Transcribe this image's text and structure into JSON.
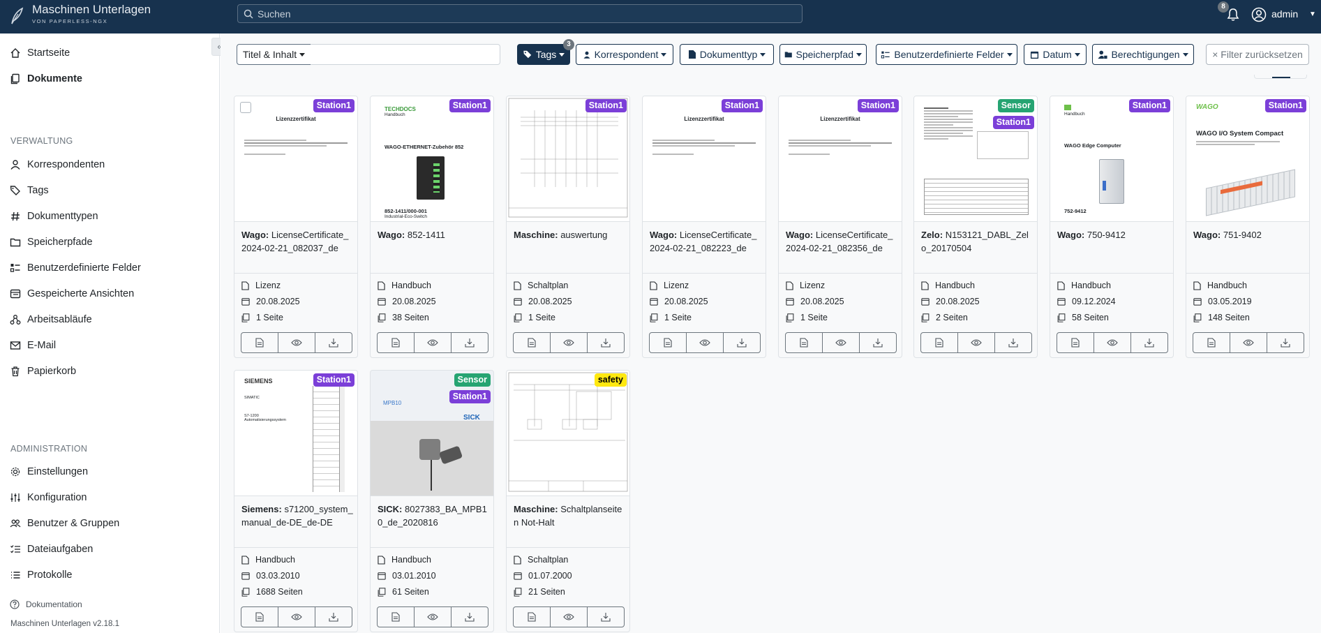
{
  "app": {
    "title": "Maschinen Unterlagen",
    "subtitle": "VON PAPERLESS-NGX",
    "version": "Maschinen Unterlagen v2.18.1"
  },
  "header": {
    "search_placeholder": "Suchen",
    "notification_count": "8",
    "user": "admin"
  },
  "sidebar": {
    "items": [
      {
        "label": "Startseite",
        "icon": "home-icon"
      },
      {
        "label": "Dokumente",
        "icon": "documents-icon"
      }
    ],
    "verwaltung_heading": "VERWALTUNG",
    "verwaltung": [
      {
        "label": "Korrespondenten",
        "icon": "person-icon"
      },
      {
        "label": "Tags",
        "icon": "tags-icon"
      },
      {
        "label": "Dokumenttypen",
        "icon": "hash-icon"
      },
      {
        "label": "Speicherpfade",
        "icon": "folder-icon"
      },
      {
        "label": "Benutzerdefinierte Felder",
        "icon": "ui-checks-icon"
      },
      {
        "label": "Gespeicherte Ansichten",
        "icon": "saved-views-icon"
      },
      {
        "label": "Arbeitsabläufe",
        "icon": "workflow-icon"
      },
      {
        "label": "E-Mail",
        "icon": "envelope-icon"
      },
      {
        "label": "Papierkorb",
        "icon": "trash-icon"
      }
    ],
    "administration_heading": "ADMINISTRATION",
    "administration": [
      {
        "label": "Einstellungen",
        "icon": "gear-icon"
      },
      {
        "label": "Konfiguration",
        "icon": "sliders-icon"
      },
      {
        "label": "Benutzer & Gruppen",
        "icon": "people-icon"
      },
      {
        "label": "Dateiaufgaben",
        "icon": "list-task-icon"
      },
      {
        "label": "Protokolle",
        "icon": "list-icon"
      }
    ],
    "documentation": "Dokumentation"
  },
  "filters": {
    "titel": "Titel & Inhalt",
    "tags": "Tags",
    "tags_count": "3",
    "korrespondent": "Korrespondent",
    "dokumenttyp": "Dokumenttyp",
    "speicherpfad": "Speicherpfad",
    "felder": "Benutzerdefinierte Felder",
    "datum": "Datum",
    "berechtigungen": "Berechtigungen",
    "reset": "× Filter zurücksetzen"
  },
  "cards": [
    {
      "correspondent": "Wago:",
      "title": "LicenseCertificate_2024-02-21_082037_de",
      "tags": [
        "Station1"
      ],
      "type": "Lizenz",
      "date": "20.08.2025",
      "pages": "1 Seite",
      "thumb": "cert",
      "thumb_title": "Lizenzzertifikat"
    },
    {
      "correspondent": "Wago:",
      "title": "852-1411",
      "tags": [
        "Station1"
      ],
      "type": "Handbuch",
      "date": "20.08.2025",
      "pages": "38 Seiten",
      "thumb": "switch",
      "thumb_logo": "TECHDOCS",
      "thumb_sub": "Handbuch",
      "thumb_title": "WAGO-ETHERNET-Zubehör 852",
      "thumb_foot": "852-1411/000-001",
      "thumb_foot2": "Industrial-Eco-Switch"
    },
    {
      "correspondent": "Maschine:",
      "title": "auswertung",
      "tags": [
        "Station1"
      ],
      "type": "Schaltplan",
      "date": "20.08.2025",
      "pages": "1 Seite",
      "thumb": "schematic"
    },
    {
      "correspondent": "Wago:",
      "title": "LicenseCertificate_2024-02-21_082223_de",
      "tags": [
        "Station1"
      ],
      "type": "Lizenz",
      "date": "20.08.2025",
      "pages": "1 Seite",
      "thumb": "cert",
      "thumb_title": "Lizenzzertifikat"
    },
    {
      "correspondent": "Wago:",
      "title": "LicenseCertificate_2024-02-21_082356_de",
      "tags": [
        "Station1"
      ],
      "type": "Lizenz",
      "date": "20.08.2025",
      "pages": "1 Seite",
      "thumb": "cert",
      "thumb_title": "Lizenzzertifikat"
    },
    {
      "correspondent": "Zelo:",
      "title": "N153121_DABL_Zelo_20170504",
      "tags": [
        "Sensor",
        "Station1"
      ],
      "type": "Handbuch",
      "date": "20.08.2025",
      "pages": "2 Seiten",
      "thumb": "datasheet"
    },
    {
      "correspondent": "Wago:",
      "title": "750-9412",
      "tags": [
        "Station1"
      ],
      "type": "Handbuch",
      "date": "09.12.2024",
      "pages": "58 Seiten",
      "thumb": "edge",
      "thumb_sub": "Handbuch",
      "thumb_title": "WAGO Edge Computer",
      "thumb_foot": "752-9412"
    },
    {
      "correspondent": "Wago:",
      "title": "751-9402",
      "tags": [
        "Station1"
      ],
      "type": "Handbuch",
      "date": "03.05.2019",
      "pages": "148 Seiten",
      "thumb": "io",
      "thumb_logo": "WAGO",
      "thumb_title": "WAGO I/O System Compact"
    },
    {
      "correspondent": "Siemens:",
      "title": "s71200_system_manual_de-DE_de-DE",
      "tags": [
        "Station1"
      ],
      "type": "Handbuch",
      "date": "03.03.2010",
      "pages": "1688 Seiten",
      "thumb": "siemens",
      "thumb_logo": "SIEMENS",
      "thumb_sub": "SIMATIC",
      "thumb_title": "S7-1200 Automatisierungssystem"
    },
    {
      "correspondent": "SICK:",
      "title": "8027383_BA_MPB10_de_2020816",
      "tags": [
        "Sensor",
        "Station1"
      ],
      "type": "Handbuch",
      "date": "03.01.2010",
      "pages": "61 Seiten",
      "thumb": "sick",
      "thumb_title": "MPB10",
      "thumb_logo": "SICK"
    },
    {
      "correspondent": "Maschine:",
      "title": "Schaltplanseiten Not-Halt",
      "tags": [
        "safety"
      ],
      "type": "Schaltplan",
      "date": "01.07.2000",
      "pages": "21 Seiten",
      "thumb": "schematic2"
    }
  ],
  "colors": {
    "navbar": "#17324e",
    "station": "#7b3fd8",
    "sensor": "#26a472",
    "safety": "#ffe810"
  }
}
